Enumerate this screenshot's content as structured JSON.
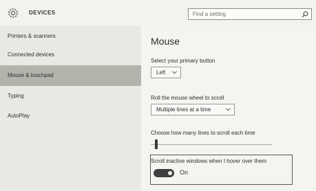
{
  "header": {
    "section_title": "DEVICES",
    "search_placeholder": "Find a setting"
  },
  "sidebar": {
    "items": [
      {
        "label": "Printers & scanners",
        "selected": false
      },
      {
        "label": "Connected devices",
        "selected": false
      },
      {
        "label": "Mouse & touchpad",
        "selected": true
      },
      {
        "label": "Typing",
        "selected": false
      },
      {
        "label": "AutoPlay",
        "selected": false
      }
    ]
  },
  "main": {
    "title": "Mouse",
    "primary_button": {
      "label": "Select your primary button",
      "value": "Left"
    },
    "wheel_scroll": {
      "label": "Roll the mouse wheel to scroll",
      "value": "Multiple lines at a time"
    },
    "lines_to_scroll": {
      "label": "Choose how many lines to scroll each time"
    },
    "scroll_inactive": {
      "label": "Scroll inactive windows when I hover over them",
      "state": "On"
    }
  },
  "colors": {
    "toggle_on": "#3f3f3f",
    "selected_nav": "#b3b2ab"
  },
  "icons": [
    "gear-icon",
    "search-icon",
    "chevron-down-icon"
  ]
}
